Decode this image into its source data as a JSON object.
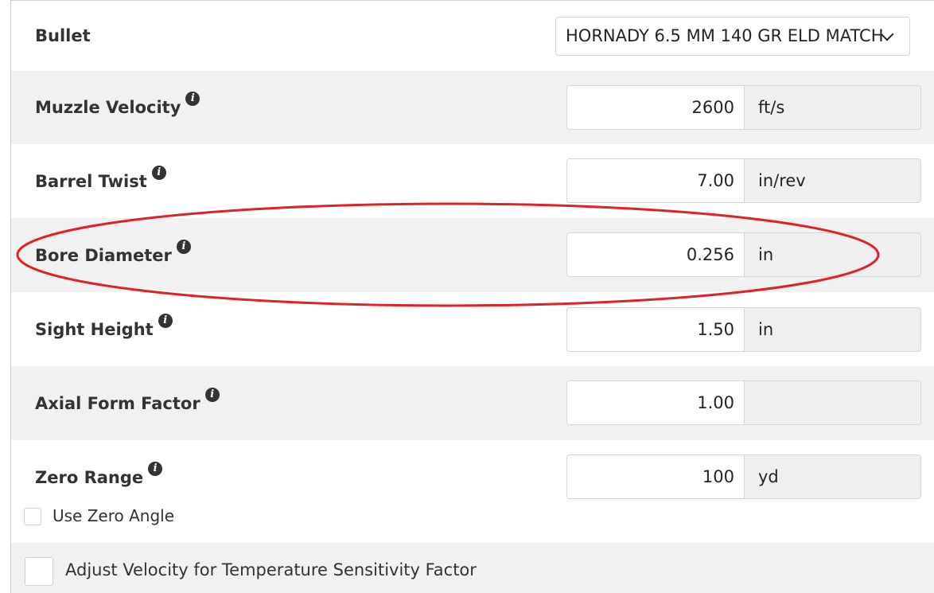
{
  "bullet": {
    "label": "Bullet",
    "selected": "HORNADY 6.5 MM 140 GR ELD MATCH"
  },
  "fields": [
    {
      "label": "Muzzle Velocity",
      "value": "2600",
      "unit": "ft/s"
    },
    {
      "label": "Barrel Twist",
      "value": "7.00",
      "unit": "in/rev"
    },
    {
      "label": "Bore Diameter",
      "value": "0.256",
      "unit": "in"
    },
    {
      "label": "Sight Height",
      "value": "1.50",
      "unit": "in"
    },
    {
      "label": "Axial Form Factor",
      "value": "1.00",
      "unit": ""
    },
    {
      "label": "Zero Range",
      "value": "100",
      "unit": "yd"
    }
  ],
  "info_glyph": "i",
  "use_zero_angle": {
    "label": "Use Zero Angle",
    "checked": false
  },
  "adjust_velocity": {
    "label": "Adjust Velocity for Temperature Sensitivity Factor",
    "checked": false
  },
  "highlight": {
    "color": "#e0202a",
    "target": "Bore Diameter"
  },
  "colors": {
    "row_alt": "#f1f1f1",
    "unit_bg": "#efefef",
    "border": "#d6d6d6"
  }
}
